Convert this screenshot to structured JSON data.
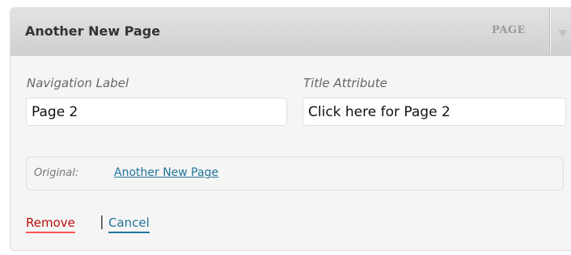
{
  "menu_item": {
    "title": "Another New Page",
    "type_label": "PAGE",
    "fields": {
      "navigation_label": {
        "label": "Navigation Label",
        "value": "Page 2"
      },
      "title_attribute": {
        "label": "Title Attribute",
        "value": "Click here for Page 2"
      }
    },
    "original": {
      "label": "Original:",
      "link_text": "Another New Page"
    },
    "actions": {
      "remove_label": "Remove",
      "separator": "|",
      "cancel_label": "Cancel"
    },
    "colors": {
      "remove": "#bc0b0b",
      "remove_underline": "#ff5555",
      "link": "#21759b",
      "panel_bg": "#f5f5f5",
      "header_bg": "#d8d8d8"
    }
  }
}
